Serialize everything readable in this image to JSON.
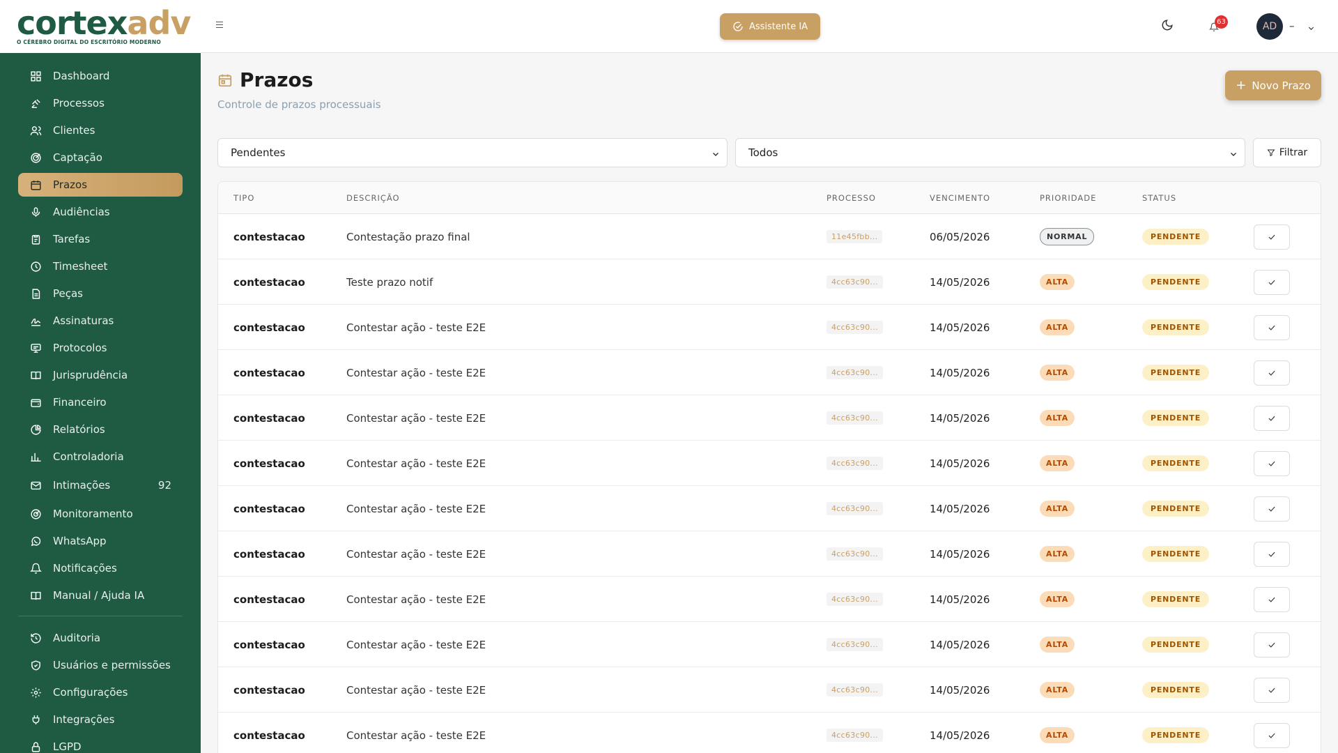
{
  "brand": {
    "logo_part1": "cortex",
    "logo_part2": "adv",
    "tagline": "O CÉREBRO DIGITAL DO ESCRITÓRIO MODERNO"
  },
  "sidebar": {
    "items": [
      {
        "label": "Dashboard",
        "icon": "dashboard-icon"
      },
      {
        "label": "Processos",
        "icon": "gavel-icon"
      },
      {
        "label": "Clientes",
        "icon": "users-icon"
      },
      {
        "label": "Captação",
        "icon": "target-icon"
      },
      {
        "label": "Prazos",
        "icon": "calendar-icon"
      },
      {
        "label": "Audiências",
        "icon": "mic-icon"
      },
      {
        "label": "Tarefas",
        "icon": "clipboard-icon"
      },
      {
        "label": "Timesheet",
        "icon": "clock-icon"
      },
      {
        "label": "Peças",
        "icon": "file-icon"
      },
      {
        "label": "Assinaturas",
        "icon": "signature-icon"
      },
      {
        "label": "Protocolos",
        "icon": "monitor-icon"
      },
      {
        "label": "Jurisprudência",
        "icon": "book-icon"
      },
      {
        "label": "Financeiro",
        "icon": "wallet-icon"
      },
      {
        "label": "Relatórios",
        "icon": "pie-icon"
      },
      {
        "label": "Controladoria",
        "icon": "bar-chart-icon"
      },
      {
        "label": "Intimações",
        "icon": "mail-icon",
        "count": "92"
      },
      {
        "label": "Monitoramento",
        "icon": "radar-icon"
      },
      {
        "label": "WhatsApp",
        "icon": "whatsapp-icon"
      },
      {
        "label": "Notificações",
        "icon": "bell-icon"
      },
      {
        "label": "Manual / Ajuda IA",
        "icon": "book-open-icon"
      }
    ],
    "admin_items": [
      {
        "label": "Auditoria",
        "icon": "history-icon"
      },
      {
        "label": "Usuários e permissões",
        "icon": "shield-icon"
      },
      {
        "label": "Configurações",
        "icon": "gear-icon"
      },
      {
        "label": "Integrações",
        "icon": "plug-icon"
      },
      {
        "label": "LGPD",
        "icon": "lock-icon"
      }
    ]
  },
  "topbar": {
    "ai_button": "Assistente IA",
    "notifications_count": "63",
    "avatar_initials": "AD",
    "user_name": "–"
  },
  "page": {
    "title": "Prazos",
    "subtitle": "Controle de prazos processuais",
    "new_button": "Novo Prazo"
  },
  "filters": {
    "status_value": "Pendentes",
    "priority_value": "Todos",
    "filter_button": "Filtrar"
  },
  "table": {
    "headers": [
      "TIPO",
      "DESCRIÇÃO",
      "PROCESSO",
      "VENCIMENTO",
      "PRIORIDADE",
      "STATUS"
    ],
    "rows": [
      {
        "tipo": "contestacao",
        "descricao": "Contestação prazo final",
        "processo": "11e45fbb...",
        "vencimento": "06/05/2026",
        "prioridade": "NORMAL",
        "status": "PENDENTE"
      },
      {
        "tipo": "contestacao",
        "descricao": "Teste prazo notif",
        "processo": "4cc63c90...",
        "vencimento": "14/05/2026",
        "prioridade": "ALTA",
        "status": "PENDENTE"
      },
      {
        "tipo": "contestacao",
        "descricao": "Contestar ação - teste E2E",
        "processo": "4cc63c90...",
        "vencimento": "14/05/2026",
        "prioridade": "ALTA",
        "status": "PENDENTE"
      },
      {
        "tipo": "contestacao",
        "descricao": "Contestar ação - teste E2E",
        "processo": "4cc63c90...",
        "vencimento": "14/05/2026",
        "prioridade": "ALTA",
        "status": "PENDENTE"
      },
      {
        "tipo": "contestacao",
        "descricao": "Contestar ação - teste E2E",
        "processo": "4cc63c90...",
        "vencimento": "14/05/2026",
        "prioridade": "ALTA",
        "status": "PENDENTE"
      },
      {
        "tipo": "contestacao",
        "descricao": "Contestar ação - teste E2E",
        "processo": "4cc63c90...",
        "vencimento": "14/05/2026",
        "prioridade": "ALTA",
        "status": "PENDENTE"
      },
      {
        "tipo": "contestacao",
        "descricao": "Contestar ação - teste E2E",
        "processo": "4cc63c90...",
        "vencimento": "14/05/2026",
        "prioridade": "ALTA",
        "status": "PENDENTE"
      },
      {
        "tipo": "contestacao",
        "descricao": "Contestar ação - teste E2E",
        "processo": "4cc63c90...",
        "vencimento": "14/05/2026",
        "prioridade": "ALTA",
        "status": "PENDENTE"
      },
      {
        "tipo": "contestacao",
        "descricao": "Contestar ação - teste E2E",
        "processo": "4cc63c90...",
        "vencimento": "14/05/2026",
        "prioridade": "ALTA",
        "status": "PENDENTE"
      },
      {
        "tipo": "contestacao",
        "descricao": "Contestar ação - teste E2E",
        "processo": "4cc63c90...",
        "vencimento": "14/05/2026",
        "prioridade": "ALTA",
        "status": "PENDENTE"
      },
      {
        "tipo": "contestacao",
        "descricao": "Contestar ação - teste E2E",
        "processo": "4cc63c90...",
        "vencimento": "14/05/2026",
        "prioridade": "ALTA",
        "status": "PENDENTE"
      },
      {
        "tipo": "contestacao",
        "descricao": "Contestar ação - teste E2E",
        "processo": "4cc63c90...",
        "vencimento": "14/05/2026",
        "prioridade": "ALTA",
        "status": "PENDENTE"
      }
    ]
  },
  "colors": {
    "sidebar_bg": "#1f5a43",
    "accent_gold": "#c9a063",
    "alta_bg": "#fcdcb8",
    "pendente_bg": "#fdf0c6"
  }
}
